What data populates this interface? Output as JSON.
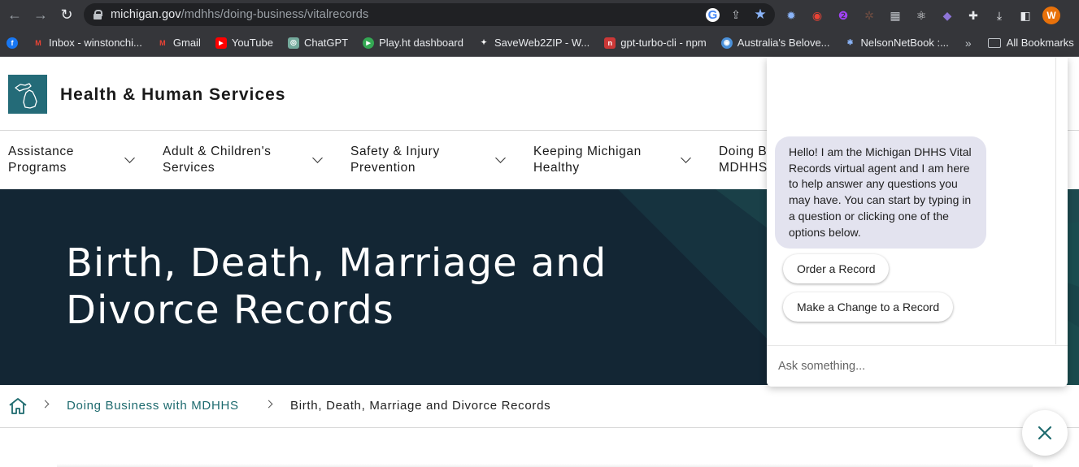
{
  "browser": {
    "url_host": "michigan.gov",
    "url_path": "/mdhhs/doing-business/vitalrecords",
    "avatar_letter": "W",
    "bookmarks": [
      {
        "label": "Inbox - winstonchi...",
        "color": "#ea4335",
        "glyph": "M"
      },
      {
        "label": "Gmail",
        "color": "#ea4335",
        "glyph": "M"
      },
      {
        "label": "YouTube",
        "color": "#ff0000",
        "glyph": "▶"
      },
      {
        "label": "ChatGPT",
        "color": "#74aa9c",
        "glyph": "◎"
      },
      {
        "label": "Play.ht dashboard",
        "color": "#34a853",
        "glyph": "▶"
      },
      {
        "label": "SaveWeb2ZIP - W...",
        "color": "#111111",
        "glyph": "✦"
      },
      {
        "label": "gpt-turbo-cli - npm",
        "color": "#cb3837",
        "glyph": "n"
      },
      {
        "label": "Australia's Belove...",
        "color": "#4a90d9",
        "glyph": "◉"
      },
      {
        "label": "NelsonNetBook :...",
        "color": "#1a73e8",
        "glyph": "✱"
      }
    ],
    "more_glyph": "»",
    "all_bookmarks": "All Bookmarks"
  },
  "site": {
    "title": "Health & Human Services"
  },
  "nav": {
    "items": [
      {
        "label_1": "Assistance",
        "label_2": "Programs"
      },
      {
        "label_1": "Adult & Children's",
        "label_2": "Services"
      },
      {
        "label_1": "Safety & Injury",
        "label_2": "Prevention"
      },
      {
        "label_1": "Keeping Michigan",
        "label_2": "Healthy"
      },
      {
        "label_1": "Doing B",
        "label_2": "MDHHS"
      }
    ]
  },
  "hero": {
    "title": "Birth, Death, Marriage and Divorce Records"
  },
  "breadcrumb": {
    "link": "Doing Business with MDHHS",
    "current": "Birth, Death, Marriage and Divorce Records"
  },
  "chat": {
    "message": "Hello! I am the Michigan DHHS Vital Records virtual agent and I am here to help answer any questions you may have. You can start by typing in a question or clicking one of the options below.",
    "quick_replies": [
      "Order a Record",
      "Make a Change to a Record"
    ],
    "input_placeholder": "Ask something..."
  },
  "colors": {
    "brand_teal": "#246b78",
    "link_teal": "#1d6a6e",
    "hero_bg": "#132634"
  }
}
